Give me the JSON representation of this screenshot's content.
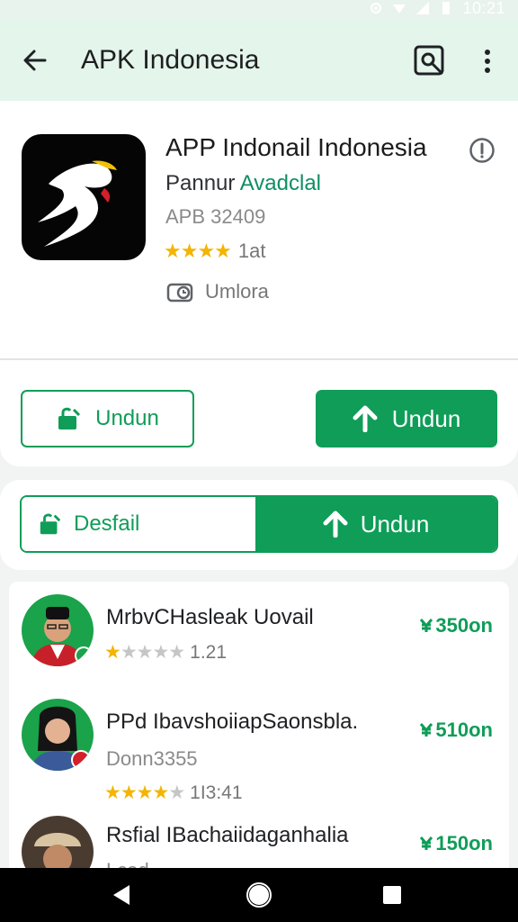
{
  "status_bar": {
    "time": "10:21"
  },
  "app_bar": {
    "title": "APK Indonesia"
  },
  "app_header": {
    "name": "APP Indonail Indonesia",
    "developer": "Pannur",
    "availability": "Avadclal",
    "version": "APB 32409",
    "stars": "★★★★",
    "rating_count": "1at",
    "category": "Umlora"
  },
  "actions": {
    "secondary_label": "Undun",
    "primary_label": "Undun"
  },
  "segmented": {
    "left_label": "Desfail",
    "right_label": "Undun"
  },
  "list": [
    {
      "name": "MrbvCHasleak Uovail",
      "sub": "",
      "stars_on": "★",
      "stars_off": "★★★★",
      "rating": "1.21",
      "price": "350on"
    },
    {
      "name": "PPd IbavshoiiapSaonsbla.",
      "sub": "Donn3355",
      "stars_on": "★★★★",
      "stars_off": "★",
      "rating": "1I3:41",
      "price": "510on"
    },
    {
      "name": "Rsfial IBachaiidaganhalia",
      "sub": "Lcad",
      "stars_on": "",
      "stars_off": "",
      "rating": "",
      "price": "150on"
    }
  ],
  "colors": {
    "accent": "#0f9d58",
    "star": "#f4b400",
    "appbar_bg": "#e4f5ec"
  }
}
